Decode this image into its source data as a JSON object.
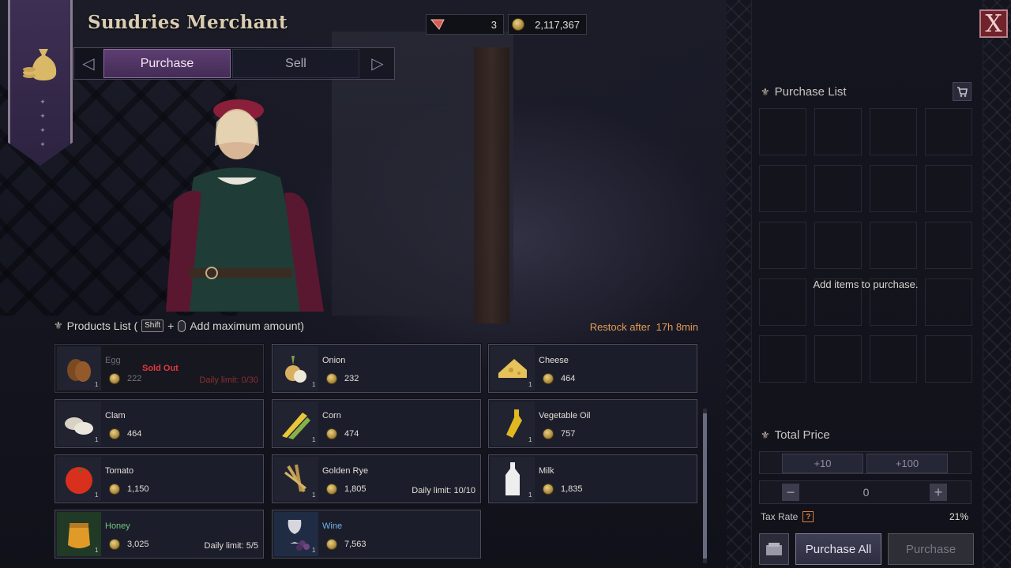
{
  "header": {
    "title": "Sundries Merchant",
    "coupon_count": "3",
    "silver": "2,117,367"
  },
  "tabs": [
    {
      "label": "Purchase",
      "active": true
    },
    {
      "label": "Sell",
      "active": false
    }
  ],
  "products": {
    "heading": "Products List (",
    "shift_key": "Shift",
    "plus": "+",
    "hint": "Add maximum amount)",
    "restock_label": "Restock after",
    "restock_time": "17h 8min",
    "items": [
      {
        "name": "Egg",
        "price": "222",
        "qty": "1",
        "status": "Sold Out",
        "limit": "Daily limit: 0/30",
        "icon": "egg-icon"
      },
      {
        "name": "Onion",
        "price": "232",
        "qty": "1",
        "icon": "onion-icon"
      },
      {
        "name": "Cheese",
        "price": "464",
        "qty": "1",
        "icon": "cheese-icon"
      },
      {
        "name": "Clam",
        "price": "464",
        "qty": "1",
        "icon": "clam-icon"
      },
      {
        "name": "Corn",
        "price": "474",
        "qty": "1",
        "icon": "corn-icon"
      },
      {
        "name": "Vegetable Oil",
        "price": "757",
        "qty": "1",
        "icon": "oil-bottle-icon"
      },
      {
        "name": "Tomato",
        "price": "1,150",
        "qty": "1",
        "icon": "tomato-icon"
      },
      {
        "name": "Golden Rye",
        "price": "1,805",
        "qty": "1",
        "limit": "Daily limit: 10/10",
        "icon": "rye-icon"
      },
      {
        "name": "Milk",
        "price": "1,835",
        "qty": "1",
        "icon": "milk-bottle-icon"
      },
      {
        "name": "Honey",
        "price": "3,025",
        "qty": "1",
        "limit": "Daily limit: 5/5",
        "icon": "honey-pot-icon"
      },
      {
        "name": "Wine",
        "price": "7,563",
        "qty": "1",
        "icon": "wine-icon"
      }
    ]
  },
  "purchase_list": {
    "heading": "Purchase List",
    "empty_message": "Add items to purchase."
  },
  "total_price": {
    "heading": "Total Price",
    "plus10": "+10",
    "plus100": "+100",
    "minus": "−",
    "plus": "+",
    "quantity": "0",
    "tax_label": "Tax Rate",
    "tax_help": "?",
    "tax_value": "21%",
    "purchase_all": "Purchase All",
    "purchase": "Purchase"
  },
  "close_label": "X",
  "colors": {
    "accent_purple": "#5e3d72",
    "restock_orange": "#e59b56",
    "sold_out_red": "#e0393e",
    "honey_green": "#70c780",
    "wine_blue": "#6fb5e8"
  }
}
